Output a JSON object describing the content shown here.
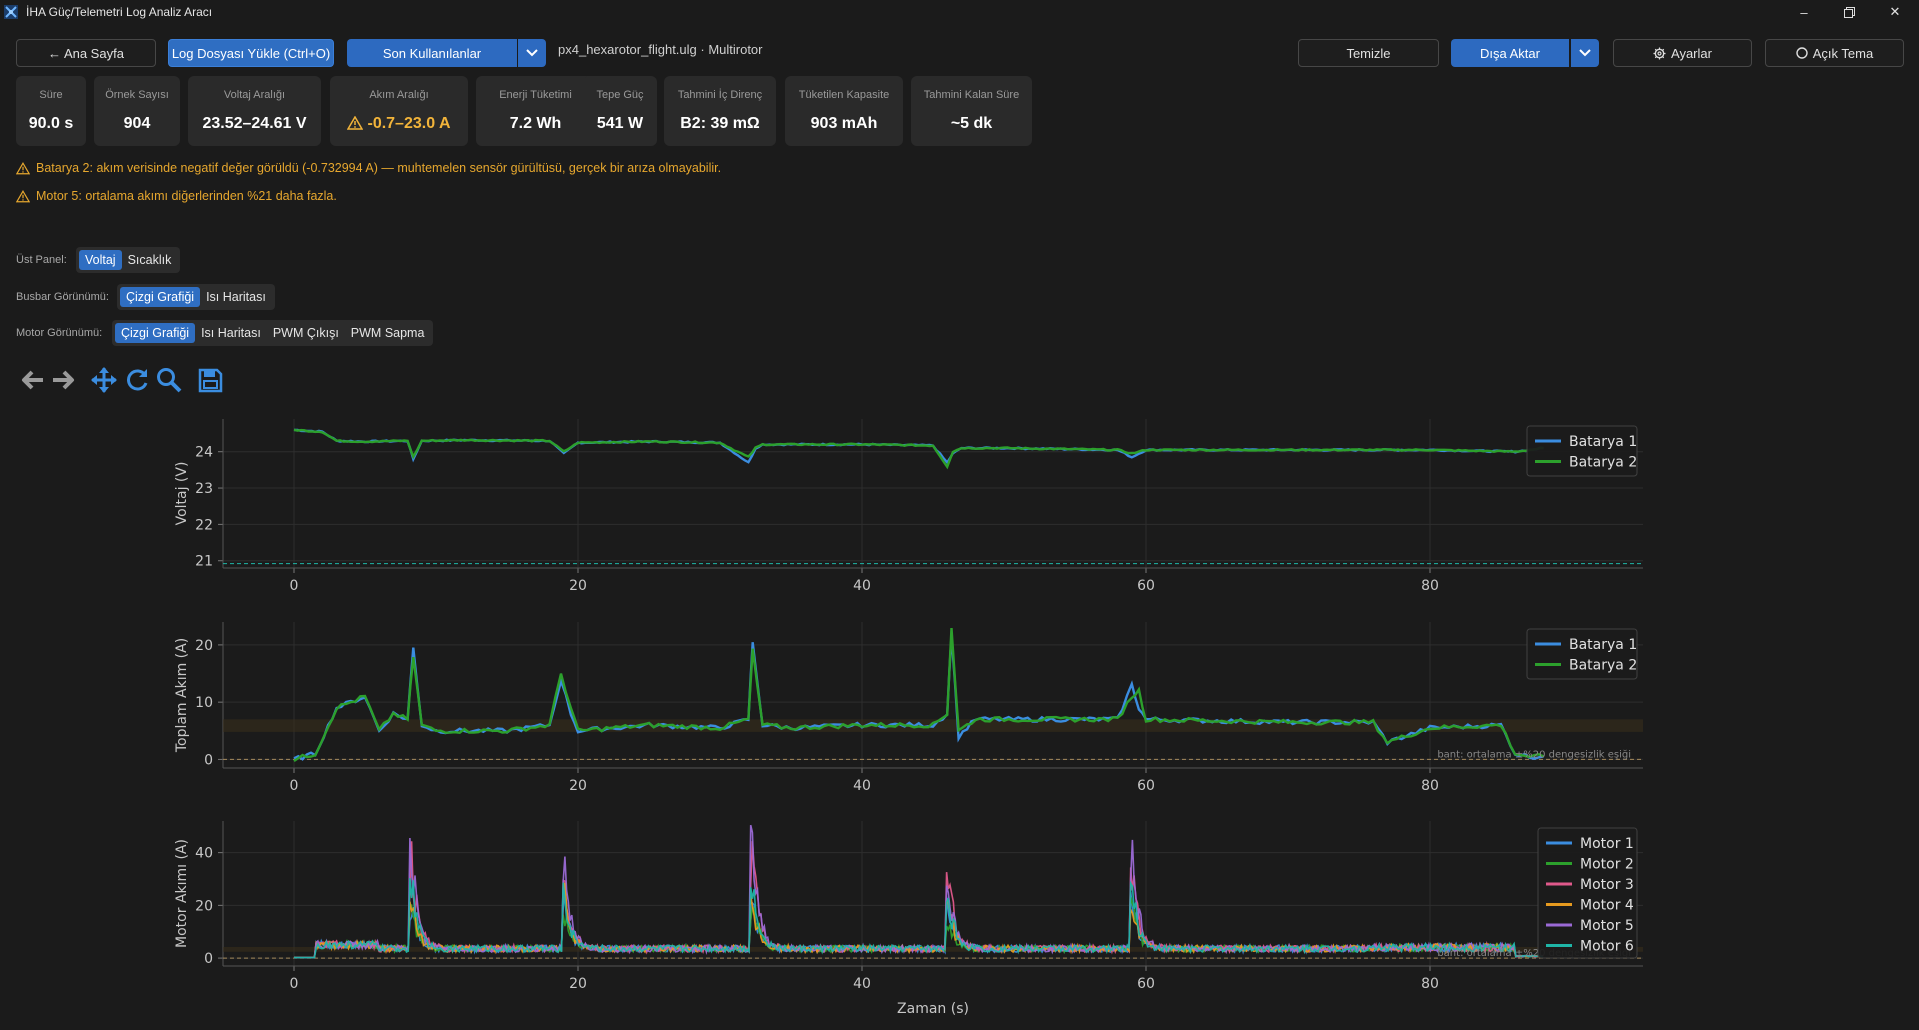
{
  "window": {
    "title": "İHA Güç/Telemetri Log Analiz Aracı",
    "minimize_icon": "minimize-icon",
    "maximize_icon": "restore-icon",
    "close_icon": "close-icon"
  },
  "toolbar": {
    "home_label": "← Ana Sayfa",
    "load_label": "Log Dosyası Yükle (Ctrl+O)",
    "recent_label": "Son Kullanılanlar",
    "file_label": "px4_hexarotor_flight.ulg · Multirotor",
    "clear_label": "Temizle",
    "export_label": "Dışa Aktar",
    "settings_label": "Ayarlar",
    "theme_label": "Açık Tema"
  },
  "stats": [
    {
      "label": "Süre",
      "value": "90.0 s"
    },
    {
      "label": "Örnek Sayısı",
      "value": "904"
    },
    {
      "label": "Voltaj Aralığı",
      "value": "23.52–24.61 V"
    },
    {
      "label": "Akım Aralığı",
      "value": "-0.7–23.0 A"
    },
    {
      "label": "Enerji Tüketimi",
      "value": "7.2 Wh"
    },
    {
      "label": "Tepe Güç",
      "value": "541 W"
    },
    {
      "label": "Tahmini İç Direnç",
      "value": "B2: 39 mΩ"
    },
    {
      "label": "Tüketilen Kapasite",
      "value": "903 mAh"
    },
    {
      "label": "Tahmini Kalan Süre",
      "value": "~5 dk"
    }
  ],
  "warnings": [
    "Batarya 2: akım verisinde negatif değer görüldü (-0.732994 A) — muhtemelen sensör gürültüsü, gerçek bir arıza olmayabilir.",
    "Motor 5: ortalama akımı diğerlerinden %21 daha fazla."
  ],
  "views": {
    "top_label": "Üst Panel:",
    "top_options": [
      "Voltaj",
      "Sıcaklık"
    ],
    "busbar_label": "Busbar Görünümü:",
    "busbar_options": [
      "Çizgi Grafiği",
      "Isı Haritası"
    ],
    "motor_label": "Motor Görünümü:",
    "motor_options": [
      "Çizgi Grafiği",
      "Isı Haritası",
      "PWM Çıkışı",
      "PWM Sapma"
    ]
  },
  "colors": {
    "accent": "#2f6ec2",
    "warning": "#f2b43a",
    "battery1": "#3b8de0",
    "battery2": "#2ca02c",
    "motor1": "#3b8de0",
    "motor2": "#2ca02c",
    "motor3": "#e0598b",
    "motor4": "#e69a1f",
    "motor5": "#9b6ad6",
    "motor6": "#1fb5a7"
  },
  "chart_data": [
    {
      "type": "line",
      "ylabel": "Voltaj (V)",
      "xlim": [
        -5,
        95
      ],
      "ylim": [
        20.8,
        24.9
      ],
      "yticks": [
        21,
        22,
        23,
        24
      ],
      "xticks": [
        0,
        20,
        40,
        60,
        80
      ],
      "grid": true,
      "legend": "top-right",
      "series": [
        {
          "name": "Batarya 1",
          "x": [
            0,
            2,
            3,
            5,
            8,
            8.4,
            9,
            12,
            18,
            19,
            20,
            25,
            30,
            32,
            32.5,
            33,
            40,
            45,
            46,
            46.4,
            47,
            50,
            58,
            59,
            60,
            70,
            76,
            80,
            86,
            88
          ],
          "y": [
            24.6,
            24.55,
            24.3,
            24.28,
            24.3,
            23.8,
            24.3,
            24.32,
            24.3,
            23.95,
            24.25,
            24.28,
            24.25,
            23.7,
            24.1,
            24.2,
            24.2,
            24.17,
            23.7,
            23.95,
            24.1,
            24.1,
            24.05,
            23.85,
            24.05,
            24.05,
            24.05,
            24.05,
            24.0,
            24.1
          ]
        },
        {
          "name": "Batarya 2",
          "x": [
            0,
            2,
            3,
            5,
            8,
            8.4,
            9,
            12,
            18,
            19,
            20,
            25,
            30,
            32,
            32.5,
            33,
            40,
            45,
            46,
            46.4,
            47,
            50,
            58,
            59,
            60,
            70,
            76,
            80,
            86,
            88
          ],
          "y": [
            24.6,
            24.55,
            24.3,
            24.28,
            24.3,
            23.85,
            24.3,
            24.32,
            24.3,
            24.0,
            24.25,
            24.28,
            24.25,
            23.85,
            24.1,
            24.2,
            24.2,
            24.17,
            23.6,
            24.0,
            24.1,
            24.1,
            24.05,
            23.95,
            24.05,
            24.05,
            24.05,
            24.05,
            24.0,
            24.1
          ]
        }
      ]
    },
    {
      "type": "line",
      "ylabel": "Toplam Akım (A)",
      "xlim": [
        -5,
        95
      ],
      "ylim": [
        -1.5,
        24
      ],
      "yticks": [
        0,
        10,
        20
      ],
      "xticks": [
        0,
        20,
        40,
        60,
        80
      ],
      "grid": true,
      "legend": "top-right",
      "annotation": "bant: ortalama ±%20 dengesizlik eşiği",
      "series": [
        {
          "name": "Batarya 1",
          "x": [
            0,
            1.5,
            3,
            4,
            5,
            6,
            7,
            8,
            8.4,
            9,
            10,
            15,
            18,
            18.8,
            19.5,
            20,
            25,
            30,
            32,
            32.3,
            33,
            35,
            40,
            45,
            46,
            46.3,
            46.8,
            48,
            50,
            58,
            59,
            59.5,
            60,
            70,
            76,
            77,
            80,
            85,
            86,
            87,
            88
          ],
          "y": [
            0,
            1,
            9,
            10,
            11,
            5,
            8,
            7,
            19.5,
            6,
            5,
            5,
            6,
            14,
            8,
            5,
            6,
            5.5,
            7,
            20.5,
            6,
            5.5,
            6,
            6,
            8,
            22,
            4,
            7,
            7,
            7,
            13,
            9,
            7,
            6.5,
            6.5,
            3,
            5.5,
            6,
            1,
            0.5,
            0.5
          ]
        },
        {
          "name": "Batarya 2",
          "x": [
            0,
            1.5,
            3,
            4,
            5,
            6,
            7,
            8,
            8.4,
            9,
            10,
            15,
            18,
            18.8,
            19.5,
            20,
            25,
            30,
            32,
            32.3,
            33,
            35,
            40,
            45,
            46,
            46.3,
            46.8,
            48,
            50,
            58,
            59,
            59.5,
            60,
            70,
            76,
            77,
            80,
            85,
            86,
            87,
            88
          ],
          "y": [
            0,
            1,
            9,
            10,
            11,
            5,
            8,
            7,
            18,
            6,
            5,
            5,
            6,
            15,
            9,
            5,
            6,
            5.5,
            7,
            19,
            6,
            5.5,
            6,
            6,
            8,
            23,
            5,
            7,
            7,
            7,
            11,
            12,
            7,
            6.5,
            6.5,
            3,
            5.5,
            6,
            1,
            0.5,
            0.5
          ]
        }
      ]
    },
    {
      "type": "line",
      "xlabel": "Zaman (s)",
      "ylabel": "Motor Akımı (A)",
      "xlim": [
        -5,
        95
      ],
      "ylim": [
        -3,
        52
      ],
      "yticks": [
        0,
        20,
        40
      ],
      "xticks": [
        0,
        20,
        40,
        60,
        80
      ],
      "grid": true,
      "legend": "top-right",
      "annotation": "bant: ortalama ±%20 dengesizlik eşiği",
      "spikes_x": [
        8.3,
        19,
        32.3,
        46,
        59
      ],
      "series": [
        {
          "name": "Motor 1",
          "peak": 28
        },
        {
          "name": "Motor 2",
          "peak": 22
        },
        {
          "name": "Motor 3",
          "peak": 48
        },
        {
          "name": "Motor 4",
          "peak": 30
        },
        {
          "name": "Motor 5",
          "peak": 50
        },
        {
          "name": "Motor 6",
          "peak": 35
        }
      ]
    }
  ]
}
